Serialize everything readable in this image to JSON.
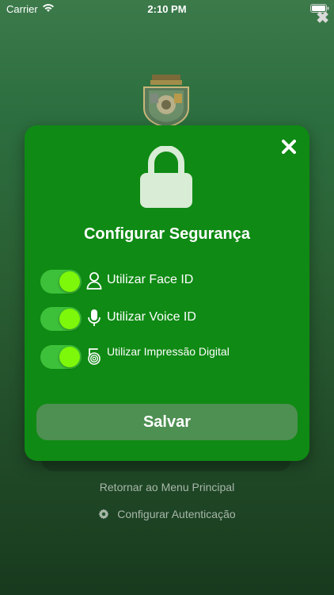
{
  "status_bar": {
    "carrier": "Carrier",
    "time": "2:10 PM"
  },
  "modal": {
    "title": "Configurar Segurança",
    "options": [
      {
        "label": "Utilizar Face ID",
        "icon": "person-icon",
        "enabled": true
      },
      {
        "label": "Utilizar Voice ID",
        "icon": "microphone-icon",
        "enabled": true
      },
      {
        "label": "Utilizar Impressão Digital",
        "icon": "fingerprint-icon",
        "enabled": true
      }
    ],
    "save_label": "Salvar"
  },
  "background": {
    "back_link": "Retornar ao Menu Principal",
    "config_link": "Configurar Autenticação"
  },
  "colors": {
    "modal_bg": "#0f8a14",
    "toggle_on": "#3dc13a",
    "toggle_knob": "#7df70a",
    "save_button": "#4e8f52",
    "link_text": "#a8b7a9"
  }
}
